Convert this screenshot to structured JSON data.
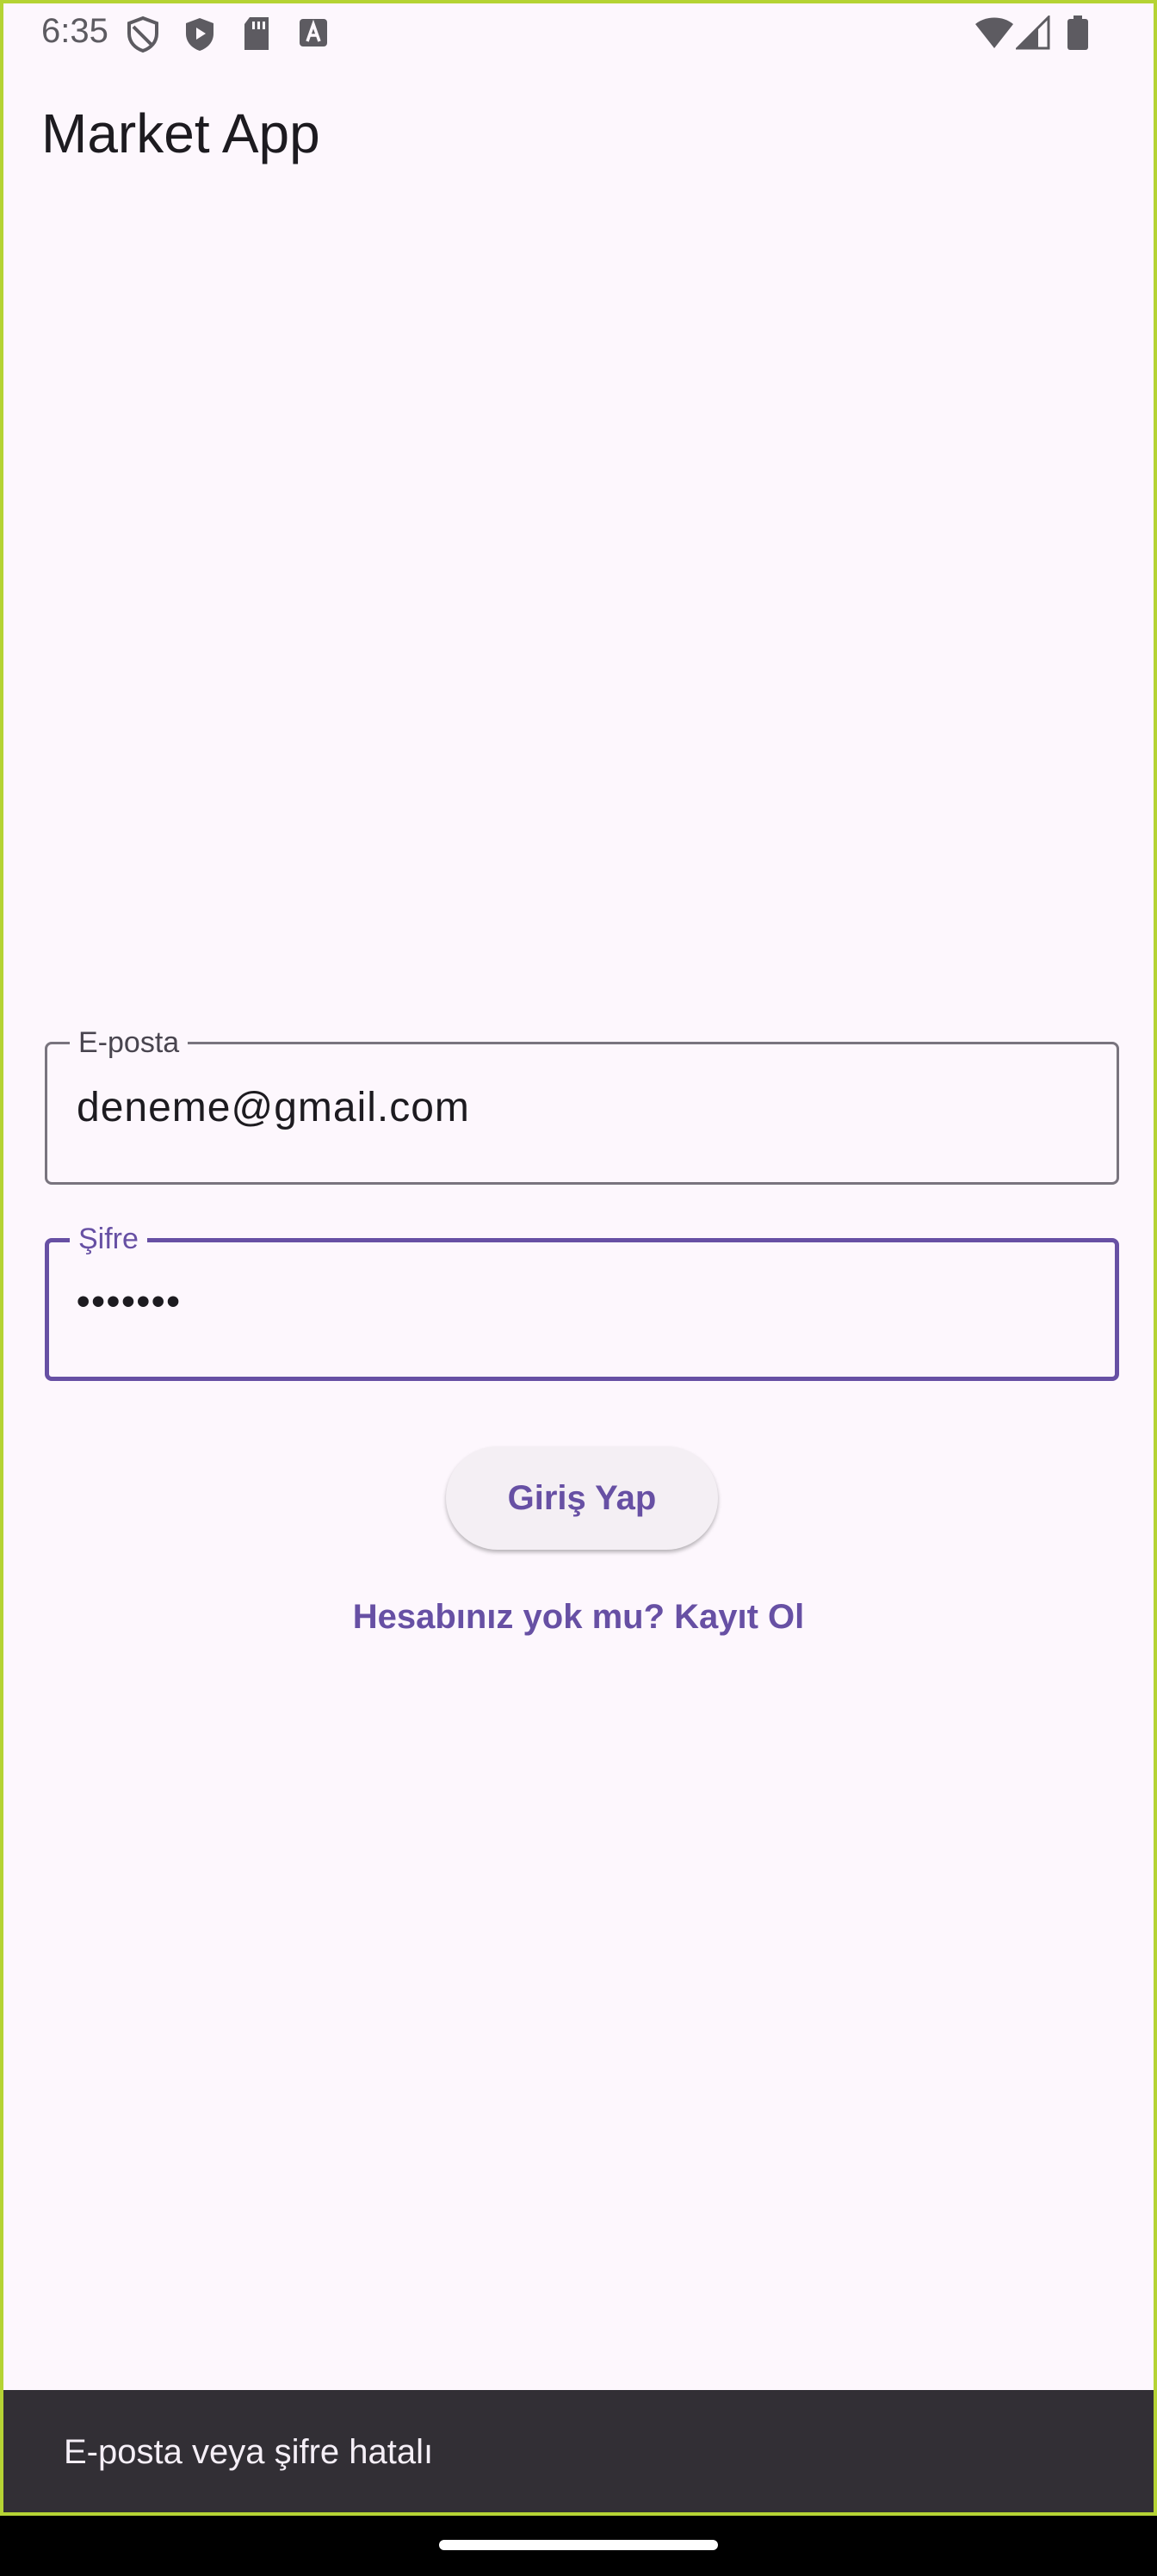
{
  "status_bar": {
    "time": "6:35",
    "left_icons": [
      "shield-outline-icon",
      "play-protect-icon",
      "sd-card-icon",
      "a-notification-icon"
    ],
    "right_icons": [
      "wifi-icon",
      "signal-icon",
      "battery-icon"
    ]
  },
  "app_bar": {
    "title": "Market App"
  },
  "form": {
    "email": {
      "label": "E-posta",
      "value": "deneme@gmail.com"
    },
    "password": {
      "label": "Şifre",
      "value": "•••••••"
    },
    "login_button": "Giriş Yap",
    "register_link": "Hesabınız yok mu? Kayıt Ol"
  },
  "snackbar": {
    "message": "E-posta veya şifre hatalı"
  },
  "colors": {
    "primary": "#6750a4",
    "background": "#fdf7fd",
    "snackbar": "#322f35",
    "outline": "#79747e"
  }
}
